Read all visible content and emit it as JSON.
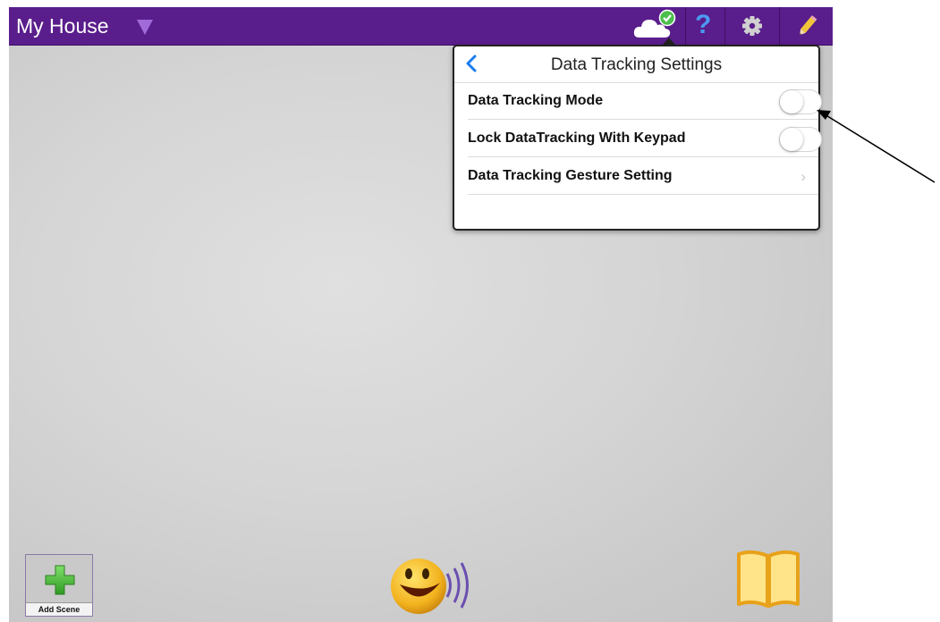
{
  "header": {
    "title": "My House",
    "icons": [
      "dropdown-caret-icon",
      "cloud-sync-icon",
      "help-icon",
      "gear-icon",
      "pencil-icon"
    ],
    "bar_color": "#5a1d8c"
  },
  "popover": {
    "title": "Data Tracking Settings",
    "rows": [
      {
        "label": "Data Tracking Mode",
        "control": "toggle",
        "on": false
      },
      {
        "label": "Lock DataTracking With Keypad",
        "control": "toggle",
        "on": false
      },
      {
        "label": "Data Tracking Gesture Setting",
        "control": "chevron",
        "chevron": "›"
      }
    ]
  },
  "footer": {
    "add_scene_label": "Add Scene"
  },
  "accent": "#1a7cf0"
}
